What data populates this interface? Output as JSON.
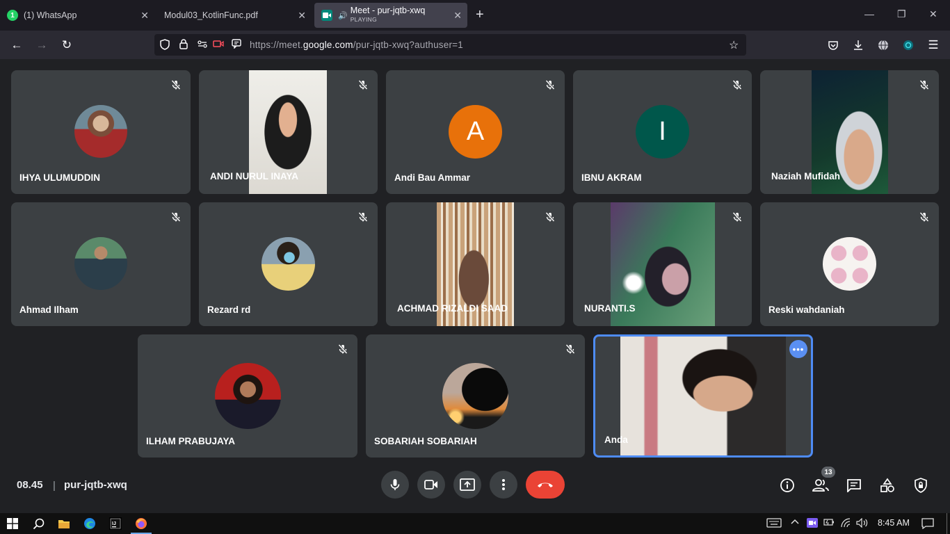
{
  "browser": {
    "tabs": [
      {
        "label": "(1) WhatsApp",
        "icon": "whatsapp-icon"
      },
      {
        "label": "Modul03_KotlinFunc.pdf",
        "icon": "pdf-icon"
      },
      {
        "label": "Meet - pur-jqtb-xwq",
        "sub": "PLAYING",
        "icon": "meet-icon",
        "active": true
      }
    ],
    "url_prefix": "https://meet.",
    "url_domain": "google.com",
    "url_suffix": "/pur-jqtb-xwq?authuser=1"
  },
  "meet": {
    "participants": [
      {
        "name": "IHYA ULUMUDDIN",
        "muted": true
      },
      {
        "name": "ANDI NURUL INAYA",
        "muted": true
      },
      {
        "name": "Andi Bau Ammar",
        "initial": "A",
        "avatar_color": "#e8710a",
        "muted": true
      },
      {
        "name": "IBNU AKRAM",
        "initial": "I",
        "avatar_color": "#00574b",
        "muted": true
      },
      {
        "name": "Naziah Mufidah",
        "muted": true
      },
      {
        "name": "Ahmad Ilham",
        "muted": true
      },
      {
        "name": "Rezard rd",
        "muted": true
      },
      {
        "name": "ACHMAD RIZALDI SAAD",
        "muted": true
      },
      {
        "name": "NURANTI.S",
        "muted": true
      },
      {
        "name": "Reski wahdaniah",
        "muted": true
      },
      {
        "name": "ILHAM PRABUJAYA",
        "muted": true
      },
      {
        "name": "SOBARIAH SOBARIAH",
        "muted": true
      },
      {
        "name": "Anda",
        "self": true
      }
    ],
    "time": "08.45",
    "separator": "|",
    "meeting_code": "pur-jqtb-xwq",
    "participant_count": "13",
    "leave_color": "#ea4335"
  },
  "taskbar": {
    "clock": "8:45 AM"
  }
}
